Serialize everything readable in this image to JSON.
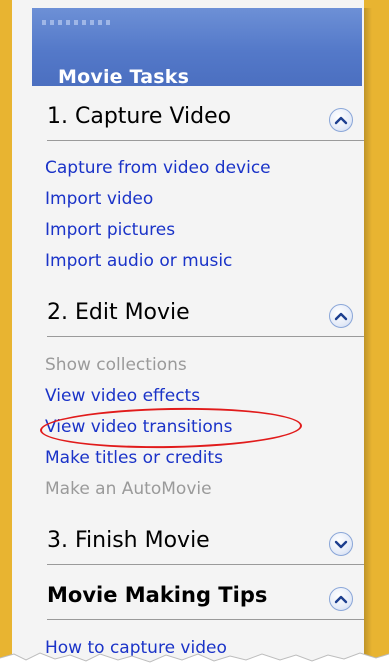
{
  "header": {
    "title": "Movie Tasks"
  },
  "sections": [
    {
      "title": "1. Capture Video",
      "state": "expanded",
      "links": [
        {
          "label": "Capture from video device",
          "enabled": true
        },
        {
          "label": "Import video",
          "enabled": true
        },
        {
          "label": "Import pictures",
          "enabled": true
        },
        {
          "label": "Import audio or music",
          "enabled": true
        }
      ]
    },
    {
      "title": "2. Edit Movie",
      "state": "expanded",
      "links": [
        {
          "label": "Show collections",
          "enabled": false
        },
        {
          "label": "View video effects",
          "enabled": true
        },
        {
          "label": "View video transitions",
          "enabled": true,
          "highlighted": true
        },
        {
          "label": "Make titles or credits",
          "enabled": true
        },
        {
          "label": "Make an AutoMovie",
          "enabled": false
        }
      ]
    },
    {
      "title": "3. Finish Movie",
      "state": "collapsed",
      "links": []
    },
    {
      "title": "Movie Making Tips",
      "state": "expanded",
      "links": [
        {
          "label": "How to capture video",
          "enabled": true
        }
      ]
    }
  ],
  "colors": {
    "frame": "#e8b431",
    "header": "#5479c9",
    "link": "#1a33c8",
    "disabled_link": "#9a9a9a",
    "highlight_ellipse": "#e11b1b"
  },
  "icons": {
    "expanded": "chevron-up-icon",
    "collapsed": "chevron-down-icon"
  }
}
